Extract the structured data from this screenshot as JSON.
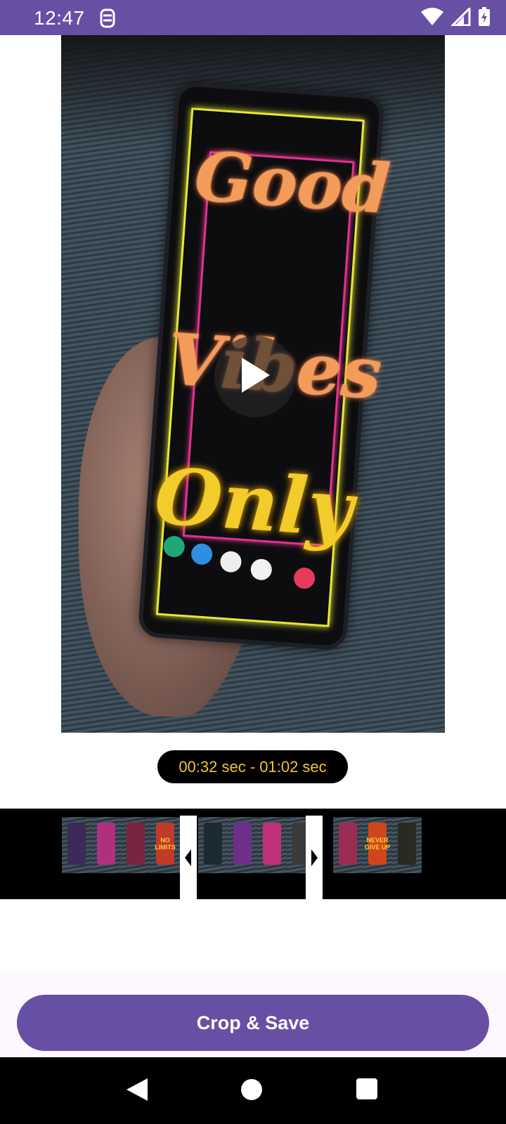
{
  "status_bar": {
    "time": "12:47",
    "icons": [
      "app-notification-icon",
      "wifi-icon",
      "signal-icon",
      "battery-charging-icon"
    ],
    "color": "#6750A4"
  },
  "video": {
    "play_icon": "play-icon"
  },
  "trim": {
    "range_label": "00:32 sec - 01:02 sec",
    "start": "00:32",
    "end": "01:02",
    "label_color": "#f4c430"
  },
  "timeline": {
    "frame_texts": [
      "",
      "",
      "",
      "NO LIMITS",
      "",
      "",
      "",
      "",
      "",
      "NEVER GIVE UP",
      "",
      "",
      "",
      ""
    ]
  },
  "actions": {
    "crop_save_label": "Crop & Save",
    "accent": "#6750A4"
  },
  "nav": {
    "back_icon": "back-triangle-icon",
    "home_icon": "home-circle-icon",
    "recents_icon": "recents-square-icon"
  }
}
